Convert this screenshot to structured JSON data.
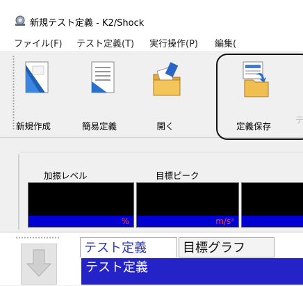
{
  "window": {
    "title": "新規テスト定義 - K2/Shock"
  },
  "menu": {
    "items": [
      {
        "label": "ファイル(F)"
      },
      {
        "label": "テスト定義(T)"
      },
      {
        "label": "実行操作(P)"
      },
      {
        "label": "編集("
      }
    ]
  },
  "toolbar": {
    "buttons": [
      {
        "label": "新規作成",
        "icon": "new-document-icon"
      },
      {
        "label": "簡易定義",
        "icon": "simple-definition-icon"
      },
      {
        "label": "開く",
        "icon": "open-folder-icon"
      },
      {
        "label": "定義保存",
        "icon": "save-definition-icon"
      }
    ],
    "next_disabled_label": "テ"
  },
  "meters": [
    {
      "label": "加振レベル",
      "unit": "%"
    },
    {
      "label": "目標ピーク",
      "unit": "m/s²"
    },
    {
      "label": "",
      "unit": ""
    }
  ],
  "bottom": {
    "tabs": [
      {
        "label": "テスト定義",
        "active": true
      },
      {
        "label": "目標グラフ",
        "active": false
      }
    ],
    "section_title": "テスト定義"
  },
  "colors": {
    "meter_bg": "#000000",
    "meter_unit_bar": "#0000d0",
    "meter_unit_text": "#ff3d3d",
    "section_header": "#2323c8",
    "active_tab_text": "#2b35b8"
  }
}
